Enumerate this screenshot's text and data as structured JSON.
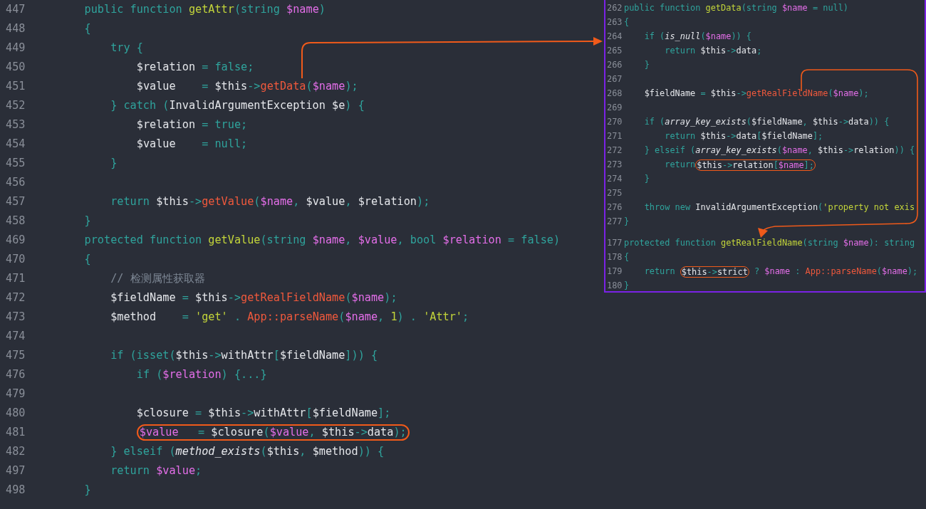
{
  "editor": {
    "lines": [
      {
        "number": "447",
        "tokens": [
          {
            "kind": "kw",
            "text": "    public function "
          },
          {
            "kind": "def",
            "text": "getAttr"
          },
          {
            "kind": "kw",
            "text": "(string "
          },
          {
            "kind": "var",
            "text": "$name"
          },
          {
            "kind": "kw",
            "text": ")"
          }
        ]
      },
      {
        "number": "448",
        "tokens": [
          {
            "kind": "kw",
            "text": "    {"
          }
        ]
      },
      {
        "number": "449",
        "tokens": [
          {
            "kind": "kw",
            "text": "        try {"
          }
        ]
      },
      {
        "number": "450",
        "tokens": [
          {
            "kind": "plain",
            "text": "            $relation "
          },
          {
            "kind": "kw",
            "text": "= false;"
          }
        ]
      },
      {
        "number": "451",
        "tokens": [
          {
            "kind": "plain",
            "text": "            $value    "
          },
          {
            "kind": "kw",
            "text": "= "
          },
          {
            "kind": "plain",
            "text": "$this"
          },
          {
            "kind": "kw",
            "text": "->"
          },
          {
            "kind": "call",
            "text": "getData"
          },
          {
            "kind": "kw",
            "text": "("
          },
          {
            "kind": "var",
            "text": "$name"
          },
          {
            "kind": "kw",
            "text": ");"
          }
        ]
      },
      {
        "number": "452",
        "tokens": [
          {
            "kind": "kw",
            "text": "        } catch ("
          },
          {
            "kind": "plain",
            "text": "InvalidArgumentException $e"
          },
          {
            "kind": "kw",
            "text": ") {"
          }
        ]
      },
      {
        "number": "453",
        "tokens": [
          {
            "kind": "plain",
            "text": "            $relation "
          },
          {
            "kind": "kw",
            "text": "= true;"
          }
        ]
      },
      {
        "number": "454",
        "tokens": [
          {
            "kind": "plain",
            "text": "            $value    "
          },
          {
            "kind": "kw",
            "text": "= null;"
          }
        ]
      },
      {
        "number": "455",
        "tokens": [
          {
            "kind": "kw",
            "text": "        }"
          }
        ]
      },
      {
        "number": "456"
      },
      {
        "number": "457",
        "tokens": [
          {
            "kind": "kw",
            "text": "        return "
          },
          {
            "kind": "plain",
            "text": "$this"
          },
          {
            "kind": "kw",
            "text": "->"
          },
          {
            "kind": "call",
            "text": "getValue"
          },
          {
            "kind": "kw",
            "text": "("
          },
          {
            "kind": "var",
            "text": "$name"
          },
          {
            "kind": "kw",
            "text": ", "
          },
          {
            "kind": "plain",
            "text": "$value"
          },
          {
            "kind": "kw",
            "text": ", "
          },
          {
            "kind": "plain",
            "text": "$relation"
          },
          {
            "kind": "kw",
            "text": ");"
          }
        ]
      },
      {
        "number": "458",
        "tokens": [
          {
            "kind": "kw",
            "text": "    }"
          }
        ]
      },
      {
        "number": "469",
        "tokens": [
          {
            "kind": "kw",
            "text": "    protected function "
          },
          {
            "kind": "def",
            "text": "getValue"
          },
          {
            "kind": "kw",
            "text": "(string "
          },
          {
            "kind": "var",
            "text": "$name"
          },
          {
            "kind": "kw",
            "text": ", "
          },
          {
            "kind": "var",
            "text": "$value"
          },
          {
            "kind": "kw",
            "text": ", bool "
          },
          {
            "kind": "var",
            "text": "$relation"
          },
          {
            "kind": "kw",
            "text": " = false)"
          }
        ]
      },
      {
        "number": "470",
        "tokens": [
          {
            "kind": "kw",
            "text": "    {"
          }
        ]
      },
      {
        "number": "471",
        "tokens": [
          {
            "kind": "comment",
            "text": "        // 检测属性获取器"
          }
        ]
      },
      {
        "number": "472",
        "tokens": [
          {
            "kind": "plain",
            "text": "        $fieldName "
          },
          {
            "kind": "kw",
            "text": "= "
          },
          {
            "kind": "plain",
            "text": "$this"
          },
          {
            "kind": "kw",
            "text": "->"
          },
          {
            "kind": "call",
            "text": "getRealFieldName"
          },
          {
            "kind": "kw",
            "text": "("
          },
          {
            "kind": "var",
            "text": "$name"
          },
          {
            "kind": "kw",
            "text": ");"
          }
        ]
      },
      {
        "number": "473",
        "tokens": [
          {
            "kind": "plain",
            "text": "        $method    "
          },
          {
            "kind": "kw",
            "text": "= "
          },
          {
            "kind": "str",
            "text": "'get'"
          },
          {
            "kind": "kw",
            "text": " . "
          },
          {
            "kind": "call",
            "text": "App::parseName"
          },
          {
            "kind": "kw",
            "text": "("
          },
          {
            "kind": "var",
            "text": "$name"
          },
          {
            "kind": "kw",
            "text": ", "
          },
          {
            "kind": "num",
            "text": "1"
          },
          {
            "kind": "kw",
            "text": ") . "
          },
          {
            "kind": "str",
            "text": "'Attr'"
          },
          {
            "kind": "kw",
            "text": ";"
          }
        ]
      },
      {
        "number": "474"
      },
      {
        "number": "475",
        "tokens": [
          {
            "kind": "kw",
            "text": "        if (isset("
          },
          {
            "kind": "plain",
            "text": "$this"
          },
          {
            "kind": "kw",
            "text": "->"
          },
          {
            "kind": "plain",
            "text": "withAttr"
          },
          {
            "kind": "kw",
            "text": "["
          },
          {
            "kind": "plain",
            "text": "$fieldName"
          },
          {
            "kind": "kw",
            "text": "])) {"
          }
        ]
      },
      {
        "number": "476",
        "tokens": [
          {
            "kind": "kw",
            "text": "            if ("
          },
          {
            "kind": "var",
            "text": "$relation"
          },
          {
            "kind": "kw",
            "text": ") {...}"
          }
        ]
      },
      {
        "number": "479"
      },
      {
        "number": "480",
        "tokens": [
          {
            "kind": "plain",
            "text": "            $closure "
          },
          {
            "kind": "kw",
            "text": "= "
          },
          {
            "kind": "plain",
            "text": "$this"
          },
          {
            "kind": "kw",
            "text": "->"
          },
          {
            "kind": "plain",
            "text": "withAttr"
          },
          {
            "kind": "kw",
            "text": "["
          },
          {
            "kind": "plain",
            "text": "$fieldName"
          },
          {
            "kind": "kw",
            "text": "];"
          }
        ]
      },
      {
        "number": "481",
        "tokens": [
          {
            "kind": "group",
            "tokens": [
              {
                "kind": "var",
                "text": "            $value"
              },
              {
                "kind": "kw",
                "text": "   = "
              },
              {
                "kind": "plain",
                "text": "$closure"
              },
              {
                "kind": "kw",
                "text": "("
              },
              {
                "kind": "var",
                "text": "$value"
              },
              {
                "kind": "kw",
                "text": ", "
              },
              {
                "kind": "plain",
                "text": "$this"
              },
              {
                "kind": "kw",
                "text": "->"
              },
              {
                "kind": "plain",
                "text": "data"
              },
              {
                "kind": "kw",
                "text": ");"
              }
            ]
          }
        ]
      },
      {
        "number": "482",
        "tokens": [
          {
            "kind": "kw",
            "text": "        } elseif ("
          },
          {
            "kind": "ital",
            "text": "method_exists"
          },
          {
            "kind": "kw",
            "text": "("
          },
          {
            "kind": "plain",
            "text": "$this"
          },
          {
            "kind": "kw",
            "text": ", "
          },
          {
            "kind": "plain",
            "text": "$method"
          },
          {
            "kind": "kw",
            "text": ")) {"
          }
        ]
      },
      {
        "number": "497",
        "tokens": [
          {
            "kind": "kw",
            "text": "        return "
          },
          {
            "kind": "var",
            "text": "$value"
          },
          {
            "kind": "kw",
            "text": ";"
          }
        ]
      },
      {
        "number": "498",
        "tokens": [
          {
            "kind": "kw",
            "text": "    }"
          }
        ]
      }
    ]
  },
  "inset": {
    "snippets": [
      {
        "lines": [
          {
            "number": "262",
            "tokens": [
              {
                "kind": "kw",
                "text": "public function "
              },
              {
                "kind": "def",
                "text": "getData"
              },
              {
                "kind": "kw",
                "text": "(string "
              },
              {
                "kind": "var",
                "text": "$name"
              },
              {
                "kind": "kw",
                "text": " = null)"
              }
            ]
          },
          {
            "number": "263",
            "tokens": [
              {
                "kind": "kw",
                "text": "{"
              }
            ]
          },
          {
            "number": "264",
            "tokens": [
              {
                "kind": "kw",
                "text": "    if ("
              },
              {
                "kind": "ital",
                "text": "is_null"
              },
              {
                "kind": "kw",
                "text": "("
              },
              {
                "kind": "var",
                "text": "$name"
              },
              {
                "kind": "kw",
                "text": ")) {"
              }
            ]
          },
          {
            "number": "265",
            "tokens": [
              {
                "kind": "kw",
                "text": "        return "
              },
              {
                "kind": "plain",
                "text": "$this"
              },
              {
                "kind": "kw",
                "text": "->"
              },
              {
                "kind": "plain",
                "text": "data"
              },
              {
                "kind": "kw",
                "text": ";"
              }
            ]
          },
          {
            "number": "266",
            "tokens": [
              {
                "kind": "kw",
                "text": "    }"
              }
            ]
          },
          {
            "number": "267"
          },
          {
            "number": "268",
            "tokens": [
              {
                "kind": "plain",
                "text": "    $fieldName "
              },
              {
                "kind": "kw",
                "text": "= "
              },
              {
                "kind": "plain",
                "text": "$this"
              },
              {
                "kind": "kw",
                "text": "->"
              },
              {
                "kind": "call",
                "text": "getRealFieldName"
              },
              {
                "kind": "kw",
                "text": "("
              },
              {
                "kind": "var",
                "text": "$name"
              },
              {
                "kind": "kw",
                "text": ");"
              }
            ]
          },
          {
            "number": "269"
          },
          {
            "number": "270",
            "tokens": [
              {
                "kind": "kw",
                "text": "    if ("
              },
              {
                "kind": "ital",
                "text": "array_key_exists"
              },
              {
                "kind": "kw",
                "text": "("
              },
              {
                "kind": "plain",
                "text": "$fieldName"
              },
              {
                "kind": "kw",
                "text": ", "
              },
              {
                "kind": "plain",
                "text": "$this"
              },
              {
                "kind": "kw",
                "text": "->"
              },
              {
                "kind": "plain",
                "text": "data"
              },
              {
                "kind": "kw",
                "text": ")) {"
              }
            ]
          },
          {
            "number": "271",
            "tokens": [
              {
                "kind": "kw",
                "text": "        return "
              },
              {
                "kind": "plain",
                "text": "$this"
              },
              {
                "kind": "kw",
                "text": "->"
              },
              {
                "kind": "plain",
                "text": "data"
              },
              {
                "kind": "kw",
                "text": "["
              },
              {
                "kind": "plain",
                "text": "$fieldName"
              },
              {
                "kind": "kw",
                "text": "];"
              }
            ]
          },
          {
            "number": "272",
            "tokens": [
              {
                "kind": "kw",
                "text": "    } elseif ("
              },
              {
                "kind": "ital",
                "text": "array_key_exists"
              },
              {
                "kind": "kw",
                "text": "("
              },
              {
                "kind": "var",
                "text": "$name"
              },
              {
                "kind": "kw",
                "text": ", "
              },
              {
                "kind": "plain",
                "text": "$this"
              },
              {
                "kind": "kw",
                "text": "->"
              },
              {
                "kind": "plain",
                "text": "relation"
              },
              {
                "kind": "kw",
                "text": ")) {"
              }
            ]
          },
          {
            "number": "273",
            "tokens": [
              {
                "kind": "kw",
                "text": "        return"
              },
              {
                "kind": "group",
                "tokens": [
                  {
                    "kind": "plain",
                    "text": "$this"
                  },
                  {
                    "kind": "kw",
                    "text": "->"
                  },
                  {
                    "kind": "plain",
                    "text": "relation"
                  },
                  {
                    "kind": "kw",
                    "text": "["
                  },
                  {
                    "kind": "var",
                    "text": "$name"
                  },
                  {
                    "kind": "kw",
                    "text": "];"
                  }
                ]
              }
            ]
          },
          {
            "number": "274",
            "tokens": [
              {
                "kind": "kw",
                "text": "    }"
              }
            ]
          },
          {
            "number": "275"
          },
          {
            "number": "276",
            "tokens": [
              {
                "kind": "kw",
                "text": "    throw new "
              },
              {
                "kind": "plain",
                "text": "InvalidArgumentException"
              },
              {
                "kind": "kw",
                "text": "("
              },
              {
                "kind": "str",
                "text": "'property not exis"
              }
            ]
          },
          {
            "number": "277",
            "tokens": [
              {
                "kind": "kw",
                "text": "}"
              }
            ]
          }
        ]
      },
      {
        "lines": [
          {
            "number": "177",
            "tokens": [
              {
                "kind": "kw",
                "text": "protected function "
              },
              {
                "kind": "def",
                "text": "getRealFieldName"
              },
              {
                "kind": "kw",
                "text": "(string "
              },
              {
                "kind": "var",
                "text": "$name"
              },
              {
                "kind": "kw",
                "text": "): string"
              }
            ]
          },
          {
            "number": "178",
            "tokens": [
              {
                "kind": "kw",
                "text": "{"
              }
            ]
          },
          {
            "number": "179",
            "tokens": [
              {
                "kind": "kw",
                "text": "    return "
              },
              {
                "kind": "group",
                "tokens": [
                  {
                    "kind": "plain",
                    "text": "$this"
                  },
                  {
                    "kind": "kw",
                    "text": "->"
                  },
                  {
                    "kind": "plain",
                    "text": "strict"
                  }
                ]
              },
              {
                "kind": "kw",
                "text": " ? "
              },
              {
                "kind": "var",
                "text": "$name"
              },
              {
                "kind": "kw",
                "text": " : "
              },
              {
                "kind": "call",
                "text": "App::parseName"
              },
              {
                "kind": "kw",
                "text": "("
              },
              {
                "kind": "var",
                "text": "$name"
              },
              {
                "kind": "kw",
                "text": ");"
              }
            ]
          },
          {
            "number": "180",
            "tokens": [
              {
                "kind": "kw",
                "text": "}"
              }
            ]
          }
        ]
      }
    ]
  }
}
